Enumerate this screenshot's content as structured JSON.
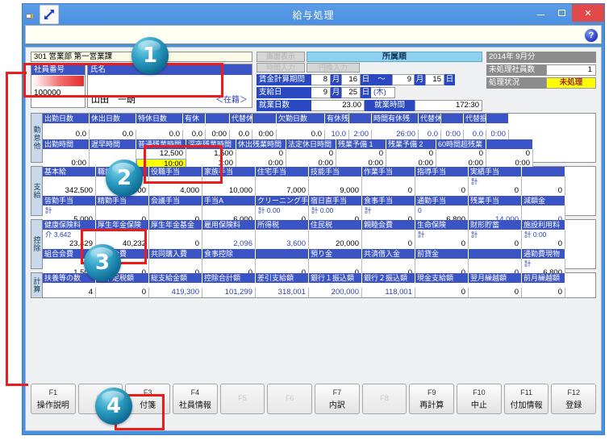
{
  "window": {
    "title": "給与処理",
    "minimize_label": "－",
    "maximize_label": "□",
    "close_label": "✕",
    "help_icon_label": "?"
  },
  "header": {
    "department": "301 営業部 第一営業課",
    "employee_number_label": "社員番号",
    "employee_number": "100000",
    "name_label": "氏名",
    "employee_name": "山田　一朗",
    "status_tag": "＜在籍＞",
    "tab_disabled_1": "画面表示",
    "tab_disabled_2": "時間入力",
    "tab_disabled_3": "円換入力",
    "tab_active": "所属順",
    "period_label": "賃金計算期間",
    "period_from_month": "8",
    "period_from_day": "16",
    "period_tilde": "～",
    "period_to_month": "9",
    "period_to_day": "15",
    "unit_month": "月",
    "unit_day": "日",
    "paydate_label": "支給日",
    "paydate_month": "9",
    "paydate_day": "25",
    "paydate_weekday": "(木)",
    "workdays_label": "就業日数",
    "workdays_value": "23.00",
    "worktime_label": "就業時間",
    "worktime_value": "172:30",
    "period_title": "2014年 9月分",
    "unprocessed_label": "未処理社員数",
    "unprocessed_value": "1",
    "status_label": "処理状況",
    "status_value": "未処理"
  },
  "sections": {
    "attendance": {
      "side_label": "勤怠他",
      "row1_headers": [
        "出勤日数",
        "休出日数",
        "特休日数",
        "有休",
        "",
        "代替休",
        "",
        "欠勤日数",
        "有休残",
        "",
        "時間有休残",
        "代替休残",
        "",
        "代替振替",
        ""
      ],
      "row1_values": [
        "0.0",
        "0.0",
        "0.0",
        "0.0",
        "0:00",
        "0.0",
        "0:00",
        "0.0",
        "10.0",
        "2:00",
        "26:00",
        "0.0",
        "0:00",
        "0.0",
        "0:00"
      ],
      "row2_headers": [
        "出勤時間",
        "遅早時間",
        "普通残業時間",
        "深夜残業時間",
        "休出残業時間",
        "法定休日時間",
        "残業予備 1",
        "残業予備 2",
        "60時間超残業",
        ""
      ],
      "row2_values_a": [
        "",
        "",
        "12,500",
        "1,500",
        "0",
        "0",
        "0",
        "0",
        "0",
        "0"
      ],
      "row2_values_b": [
        "0:00",
        "",
        "10:00",
        "1:00",
        "0:00",
        "0:00",
        "0:00",
        "0:00",
        "0:00",
        "0:00"
      ]
    },
    "payment": {
      "side_label": "支給",
      "row1_headers": [
        "基本給",
        "職能給",
        "役職手当",
        "家族手当",
        "住宅手当",
        "技能手当",
        "作業手当",
        "指導手当",
        "実績手当",
        ""
      ],
      "row1_tags": [
        "",
        "",
        "",
        "",
        "",
        "",
        "",
        "",
        "計",
        ""
      ],
      "row1_values": [
        "342,500",
        "15,000",
        "4,000",
        "10,000",
        "7,000",
        "9,000",
        "0",
        "0",
        "0",
        "0"
      ],
      "row2_headers": [
        "皆勤手当",
        "精勤手当",
        "会議手当",
        "手当A",
        "クリーニング手当",
        "宿日直手当",
        "食事手当",
        "通勤手当",
        "残業手当",
        "減額金"
      ],
      "row2_tags": [
        "計",
        "",
        "",
        "",
        "計 0.00",
        "計 0.00",
        "計",
        "0",
        "",
        ""
      ],
      "row2_values": [
        "5,000",
        "0",
        "0",
        "6,000",
        "0",
        "0",
        "0",
        "6,800",
        "14,000",
        "0"
      ]
    },
    "deduction": {
      "side_label": "控除",
      "row1_headers": [
        "健康保険料",
        "厚生年金保険",
        "厚生年金基金",
        "雇用保険料",
        "所得税",
        "住民税",
        "親睦会費",
        "生命保険",
        "財形貯蓄",
        "施設利用料"
      ],
      "row1_tags": [
        "介 3,642",
        "",
        "",
        "",
        "",
        "",
        "",
        "計",
        "計",
        "計 0:00"
      ],
      "row1_values": [
        "23,429",
        "40,232",
        "0",
        "2,096",
        "3,600",
        "20,000",
        "0",
        "0",
        "0",
        "0"
      ],
      "row2_headers": [
        "組合会費",
        "共済会費",
        "共同購入費",
        "食事控除",
        "",
        "預り金",
        "共済借入金",
        "前貸金",
        "",
        "通勤費現物"
      ],
      "row2_tags": [
        "",
        "",
        "",
        "",
        "",
        "",
        "",
        "",
        "",
        "計"
      ],
      "row2_values": [
        "1,500",
        "0",
        "0",
        "0",
        "0",
        "0",
        "0",
        "0",
        "0",
        "6,800"
      ]
    },
    "calculation": {
      "side_label": "計算",
      "headers": [
        "扶養等の数",
        "過不足税額",
        "総支給金額",
        "控除合計額",
        "差引支給額",
        "銀行１振込額",
        "銀行２振込額",
        "現金支給額",
        "翌月繰越額",
        "前月繰越額"
      ],
      "values": [
        "4",
        "0",
        "419,300",
        "101,299",
        "318,001",
        "200,000",
        "118,001",
        "0",
        "0",
        "0"
      ]
    }
  },
  "function_keys": [
    {
      "key": "F1",
      "name": "操作説明",
      "enabled": true
    },
    {
      "key": "F2",
      "name": "",
      "enabled": false
    },
    {
      "key": "F3",
      "name": "付箋",
      "enabled": true
    },
    {
      "key": "F4",
      "name": "社員情報",
      "enabled": true
    },
    {
      "key": "F5",
      "name": "",
      "enabled": false
    },
    {
      "key": "F6",
      "name": "",
      "enabled": false
    },
    {
      "key": "F7",
      "name": "内訳",
      "enabled": true
    },
    {
      "key": "F8",
      "name": "",
      "enabled": false
    },
    {
      "key": "F9",
      "name": "再計算",
      "enabled": true
    },
    {
      "key": "F10",
      "name": "中止",
      "enabled": true
    },
    {
      "key": "F11",
      "name": "付加情報",
      "enabled": true
    },
    {
      "key": "F12",
      "name": "登録",
      "enabled": true
    }
  ],
  "annotations": {
    "badge_1": "1",
    "badge_2": "2",
    "badge_3": "3",
    "badge_4": "4",
    "highlight_color": "#ee1b1b"
  }
}
